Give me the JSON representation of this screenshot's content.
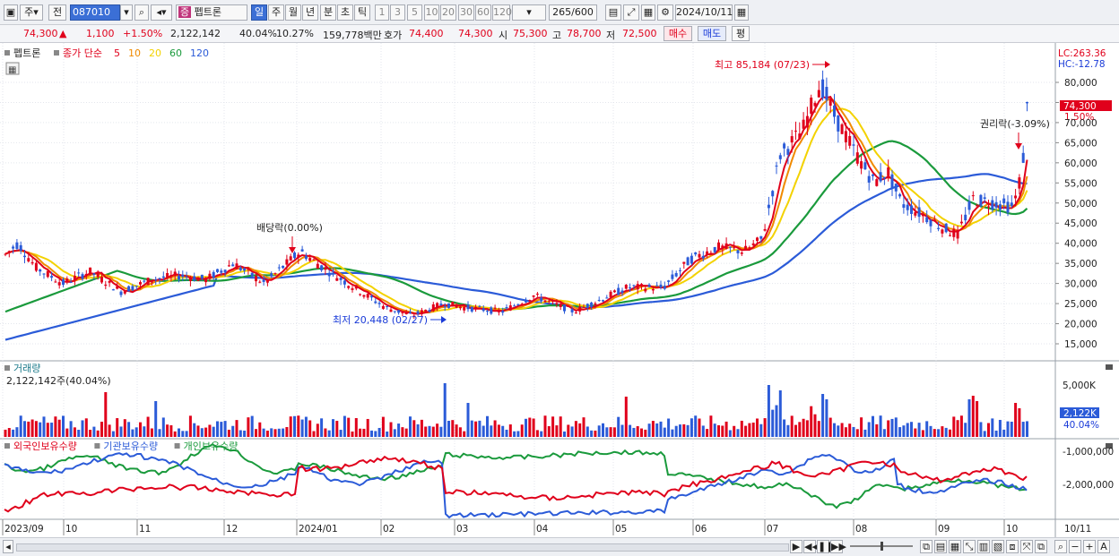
{
  "toolbar": {
    "mode": "주",
    "prev": "전",
    "code": "087010",
    "name": "펩트론",
    "periods": [
      "일",
      "주",
      "월",
      "년",
      "분",
      "초",
      "틱"
    ],
    "intervals": [
      "1",
      "3",
      "5",
      "10",
      "20",
      "30",
      "60",
      "120"
    ],
    "count": "265",
    "count_total": "/600",
    "date": "2024/10/11"
  },
  "quote": {
    "price": "74,300",
    "arrow": "▲",
    "change": "1,100",
    "change_pct": "+1.50%",
    "volume": "2,122,142",
    "vol_ratio": "40.04%",
    "turnover": "10.27%",
    "amount": "159,778백만",
    "hoga_label": "호가",
    "ask": "74,400",
    "bid": "74,300",
    "open_label": "시",
    "open": "75,300",
    "high_label": "고",
    "high": "78,700",
    "low_label": "저",
    "low": "72,500",
    "buy": "매수",
    "sell": "매도",
    "avg": "평"
  },
  "legend": {
    "stock": "펩트론",
    "close_label": "종가 단순",
    "ma": [
      {
        "p": "5",
        "color": "#e0001b"
      },
      {
        "p": "10",
        "color": "#f08a00"
      },
      {
        "p": "20",
        "color": "#f3d200"
      },
      {
        "p": "60",
        "color": "#1a9a3c"
      },
      {
        "p": "120",
        "color": "#2b5bd8"
      }
    ]
  },
  "annotations": {
    "high": "최고 85,184 (07/23)",
    "low": "최저 20,448 (02/27)",
    "dividend": "배당락(0.00%)",
    "rights": "권리락(-3.09%)"
  },
  "price_axis": {
    "lc": "LC:263.36",
    "hc": "HC:-12.78",
    "ticks": [
      "80,000",
      "75,000",
      "70,000",
      "65,000",
      "60,000",
      "55,000",
      "50,000",
      "45,000",
      "40,000",
      "35,000",
      "30,000",
      "25,000",
      "20,000",
      "15,000"
    ],
    "current": "74,300",
    "current_pct": "1.50%"
  },
  "volume": {
    "title": "거래량",
    "value": "2,122,142주(40.04%)",
    "axis_tick": "5,000K",
    "current": "2,122K",
    "current_pct": "40.04%"
  },
  "holdings": {
    "series": [
      {
        "name": "외국인보유수량",
        "color": "#e0001b"
      },
      {
        "name": "기관보유수량",
        "color": "#2b5bd8"
      },
      {
        "name": "개인보유수량",
        "color": "#1a9a3c"
      }
    ],
    "ticks": [
      "-1,000,000",
      "-2,000,000"
    ]
  },
  "xaxis": {
    "labels": [
      "2023/09",
      "10",
      "11",
      "12",
      "2024/01",
      "02",
      "03",
      "04",
      "05",
      "06",
      "07",
      "08",
      "09",
      "10",
      "10/11"
    ]
  },
  "colors": {
    "up": "#e0001b",
    "down": "#2b5bd8",
    "ma5": "#e0001b",
    "ma10": "#f08a00",
    "ma20": "#f3d200",
    "ma60": "#1a9a3c",
    "ma120": "#2b5bd8"
  }
}
